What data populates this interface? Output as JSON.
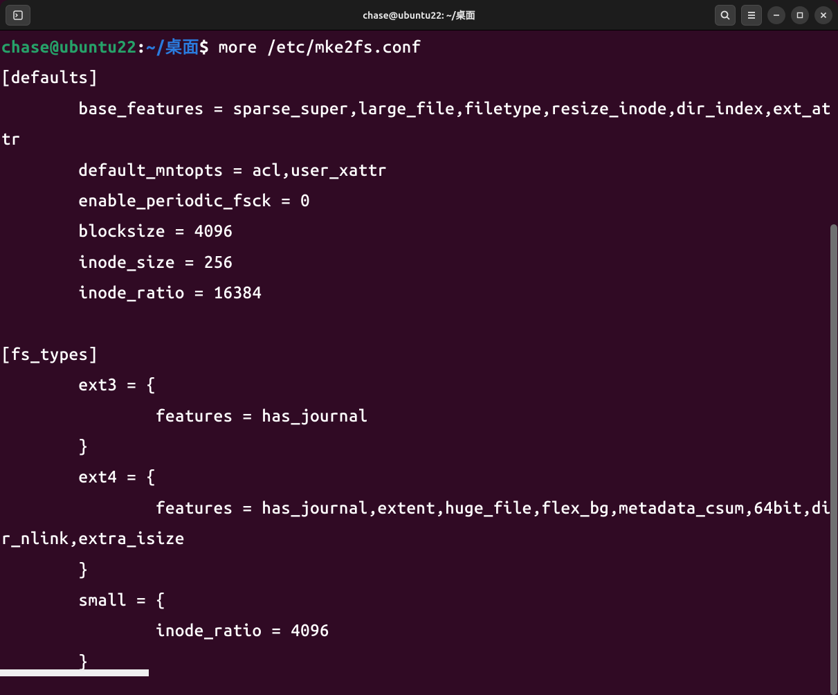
{
  "window": {
    "title": "chase@ubuntu22: ~/桌面"
  },
  "prompt": {
    "user_host": "chase@ubuntu22",
    "colon": ":",
    "path": "~/桌面",
    "dollar": "$ ",
    "command": "more /etc/mke2fs.conf"
  },
  "output": "[defaults]\n        base_features = sparse_super,large_file,filetype,resize_inode,dir_index,ext_attr\n        default_mntopts = acl,user_xattr\n        enable_periodic_fsck = 0\n        blocksize = 4096\n        inode_size = 256\n        inode_ratio = 16384\n\n[fs_types]\n        ext3 = {\n                features = has_journal\n        }\n        ext4 = {\n                features = has_journal,extent,huge_file,flex_bg,metadata_csum,64bit,dir_nlink,extra_isize\n        }\n        small = {\n                inode_ratio = 4096\n        }"
}
